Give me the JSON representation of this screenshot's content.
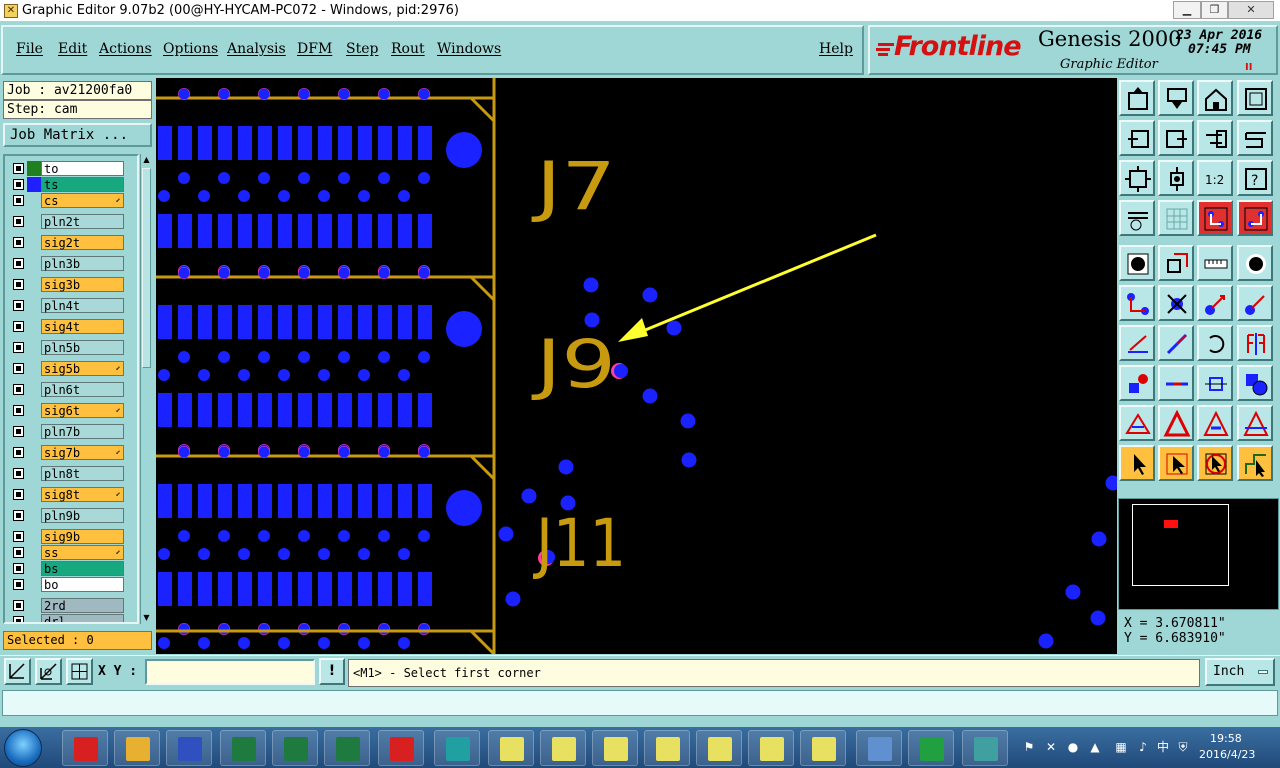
{
  "window": {
    "title": "Graphic Editor 9.07b2 (00@HY-HYCAM-PC072 - Windows, pid:2976)",
    "icon": "app-icon"
  },
  "menu": {
    "items": [
      "File",
      "Edit",
      "Actions",
      "Options",
      "Analysis",
      "DFM",
      "Step",
      "Rout",
      "Windows"
    ],
    "help": "Help"
  },
  "brand": {
    "logo": "Frontline",
    "product": "Genesis 2000",
    "subtitle": "Graphic Editor",
    "date": "23 Apr 2016",
    "time": "07:45 PM",
    "pause_glyph": "II"
  },
  "job": {
    "job_label": "Job : av21200fa0",
    "step_label": "Step: cam",
    "matrix_button": "Job Matrix ..."
  },
  "layers": [
    {
      "name": "to",
      "swatch": "#208020",
      "fill": "#ffffff",
      "flag": ""
    },
    {
      "name": "ts",
      "swatch": "#2020ff",
      "fill": "#18a880",
      "flag": ""
    },
    {
      "name": "cs",
      "swatch": "",
      "fill": "#ffc040",
      "flag": "⬋"
    },
    {
      "name": "pln2t",
      "swatch": "",
      "fill": "#a8d8d8",
      "flag": ""
    },
    {
      "name": "sig2t",
      "swatch": "",
      "fill": "#ffc040",
      "flag": ""
    },
    {
      "name": "pln3b",
      "swatch": "",
      "fill": "#a8d8d8",
      "flag": ""
    },
    {
      "name": "sig3b",
      "swatch": "",
      "fill": "#ffc040",
      "flag": ""
    },
    {
      "name": "pln4t",
      "swatch": "",
      "fill": "#a8d8d8",
      "flag": ""
    },
    {
      "name": "sig4t",
      "swatch": "",
      "fill": "#ffc040",
      "flag": ""
    },
    {
      "name": "pln5b",
      "swatch": "",
      "fill": "#a8d8d8",
      "flag": ""
    },
    {
      "name": "sig5b",
      "swatch": "",
      "fill": "#ffc040",
      "flag": "⬋"
    },
    {
      "name": "pln6t",
      "swatch": "",
      "fill": "#a8d8d8",
      "flag": ""
    },
    {
      "name": "sig6t",
      "swatch": "",
      "fill": "#ffc040",
      "flag": "⬋"
    },
    {
      "name": "pln7b",
      "swatch": "",
      "fill": "#a8d8d8",
      "flag": ""
    },
    {
      "name": "sig7b",
      "swatch": "",
      "fill": "#ffc040",
      "flag": "⬋"
    },
    {
      "name": "pln8t",
      "swatch": "",
      "fill": "#a8d8d8",
      "flag": ""
    },
    {
      "name": "sig8t",
      "swatch": "",
      "fill": "#ffc040",
      "flag": "⬋"
    },
    {
      "name": "pln9b",
      "swatch": "",
      "fill": "#a8d8d8",
      "flag": ""
    },
    {
      "name": "sig9b",
      "swatch": "",
      "fill": "#ffc040",
      "flag": ""
    },
    {
      "name": "ss",
      "swatch": "",
      "fill": "#ffc040",
      "flag": "⬋"
    },
    {
      "name": "bs",
      "swatch": "",
      "fill": "#18a880",
      "flag": ""
    },
    {
      "name": "bo",
      "swatch": "",
      "fill": "#ffffff",
      "flag": ""
    },
    {
      "name": "2rd",
      "swatch": "",
      "fill": "#a0b8c0",
      "flag": ""
    },
    {
      "name": "drl",
      "swatch": "",
      "fill": "#a0b8c0",
      "flag": ""
    }
  ],
  "selected_label": "Selected : 0",
  "canvas": {
    "refdes": [
      "J7",
      "J9",
      "J11"
    ],
    "colors": {
      "background": "#000000",
      "pad": "#1a22ff",
      "outline": "#c89a10",
      "highlight": "#ff3fa0",
      "arrow": "#ffff30"
    }
  },
  "coords": {
    "x": "X = 3.670811\"",
    "y": "Y = 6.683910\""
  },
  "command": {
    "xy_label": "X Y :",
    "xy_value": "",
    "bang": "!",
    "prompt": "<M1> - Select first corner",
    "units": "Inch"
  },
  "taskbar": {
    "time": "19:58",
    "date": "2016/4/23"
  }
}
